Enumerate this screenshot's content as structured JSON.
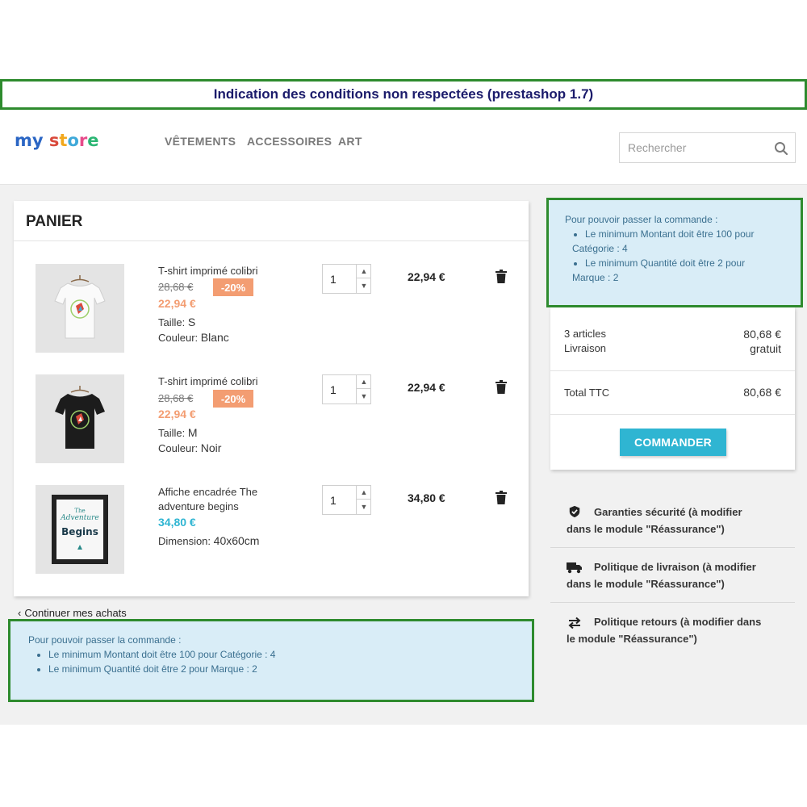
{
  "banner": {
    "title": "Indication des conditions non respectées (prestashop 1.7)"
  },
  "header": {
    "logo": {
      "parts": [
        "my",
        " ",
        "s",
        "t",
        "o",
        "r",
        "e"
      ]
    },
    "nav": [
      "VÊTEMENTS",
      "ACCESSOIRES",
      "ART"
    ],
    "search": {
      "placeholder": "Rechercher"
    }
  },
  "cart": {
    "title": "PANIER",
    "items": [
      {
        "name": "T-shirt imprimé colibri",
        "old_price": "28,68 €",
        "discount": "-20%",
        "price": "22,94 €",
        "attr1_label": "Taille:",
        "attr1_value": "S",
        "attr2_label": "Couleur:",
        "attr2_value": "Blanc",
        "qty": "1",
        "total": "22,94 €"
      },
      {
        "name": "T-shirt imprimé colibri",
        "old_price": "28,68 €",
        "discount": "-20%",
        "price": "22,94 €",
        "attr1_label": "Taille:",
        "attr1_value": "M",
        "attr2_label": "Couleur:",
        "attr2_value": "Noir",
        "qty": "1",
        "total": "22,94 €"
      },
      {
        "name_line1": "Affiche encadrée The",
        "name_line2": "adventure begins",
        "price": "34,80 €",
        "attr1_label": "Dimension:",
        "attr1_value": "40x60cm",
        "qty": "1",
        "total": "34,80 €",
        "poster_lines": [
          "The",
          "Adventure",
          "Begins"
        ]
      }
    ],
    "continue_label": "Continuer mes achats"
  },
  "alerts": {
    "intro": "Pour pouvoir passer la commande :",
    "right_items": [
      [
        "Le minimum Montant doit être 100 pour",
        "Catégorie : 4"
      ],
      [
        "Le minimum Quantité doit être 2 pour",
        "Marque : 2"
      ]
    ],
    "bottom_items": [
      "Le minimum Montant doit être 100 pour Catégorie : 4",
      "Le minimum Quantité doit être 2 pour Marque : 2"
    ]
  },
  "summary": {
    "articles_label": "3 articles",
    "articles_value": "80,68 €",
    "shipping_label": "Livraison",
    "shipping_value": "gratuit",
    "total_label": "Total TTC",
    "total_value": "80,68 €",
    "order_button": "COMMANDER"
  },
  "reassurance": [
    {
      "icon": "shield-icon",
      "line1": "Garanties sécurité (à modifier",
      "line2": "dans le module \"Réassurance\")"
    },
    {
      "icon": "truck-icon",
      "line1": "Politique de livraison (à modifier",
      "line2": "dans le module \"Réassurance\")"
    },
    {
      "icon": "exchange-arrows-icon",
      "line1": "Politique retours (à modifier dans",
      "line2": "le module \"Réassurance\")"
    }
  ],
  "colors": {
    "accent": "#2fb5d2",
    "discount": "#f39d72",
    "highlight_border": "#2e8b2e",
    "alert_bg": "#d9edf7",
    "logo": [
      "#2b66c4",
      "#2b66c4",
      "#d9493b",
      "#f2a81d",
      "#3fa9d9",
      "#e74c8b",
      "#2bb673"
    ]
  }
}
